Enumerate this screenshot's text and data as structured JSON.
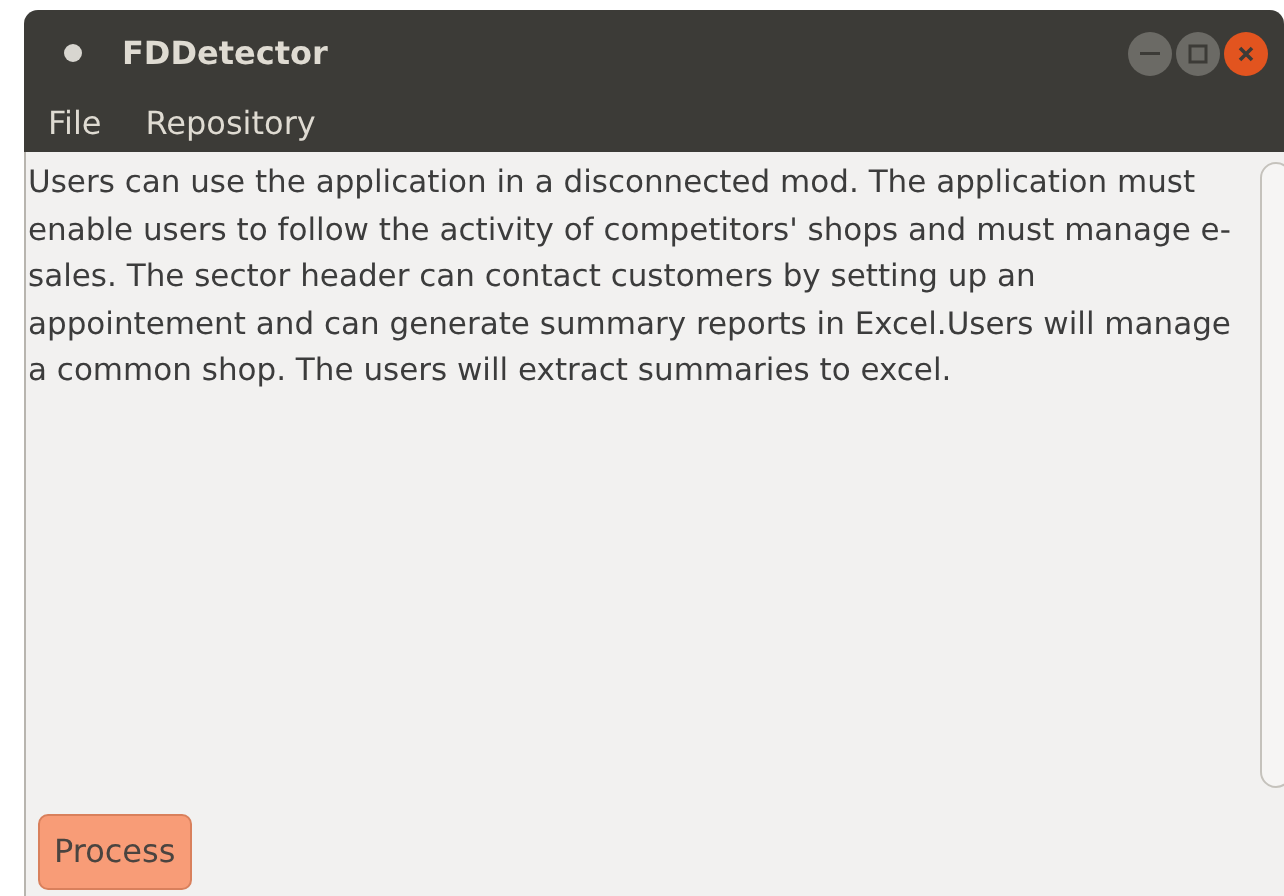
{
  "window": {
    "title": "FDDetector"
  },
  "menu": [
    {
      "label": "File"
    },
    {
      "label": "Repository"
    }
  ],
  "text_area": {
    "value": "Users can use the application in a disconnected mod. The application must enable users to follow the activity of competitors' shops and must manage e-sales. The sector header can contact customers by setting up an appointement and can generate summary reports in Excel.Users will manage a common shop. The users will extract summaries to excel."
  },
  "buttons": [
    {
      "label": "Process"
    }
  ]
}
